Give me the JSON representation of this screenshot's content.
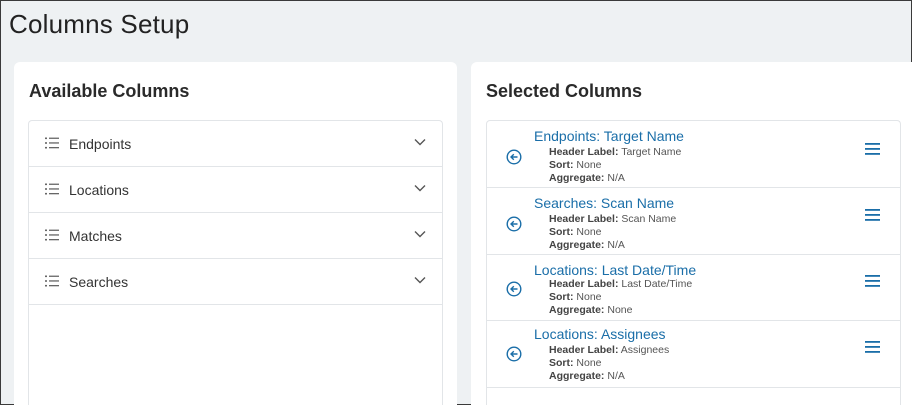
{
  "page": {
    "title": "Columns Setup"
  },
  "available": {
    "title": "Available Columns",
    "items": [
      {
        "label": "Endpoints"
      },
      {
        "label": "Locations"
      },
      {
        "label": "Matches"
      },
      {
        "label": "Searches"
      }
    ]
  },
  "selected": {
    "title": "Selected Columns",
    "header_label_key": "Header Label:",
    "sort_key": "Sort:",
    "aggregate_key": "Aggregate:",
    "items": [
      {
        "title": "Endpoints: Target Name",
        "header_label": "Target Name",
        "sort": "None",
        "aggregate": "N/A"
      },
      {
        "title": "Searches: Scan Name",
        "header_label": "Scan Name",
        "sort": "None",
        "aggregate": "N/A"
      },
      {
        "title": "Locations: Last Date/Time",
        "header_label": "Last Date/Time",
        "sort": "None",
        "aggregate": "None"
      },
      {
        "title": "Locations: Assignees",
        "header_label": "Assignees",
        "sort": "None",
        "aggregate": "N/A"
      }
    ]
  },
  "colors": {
    "link": "#1a6ea8",
    "icon": "#1a6ea8",
    "text": "#333333"
  }
}
